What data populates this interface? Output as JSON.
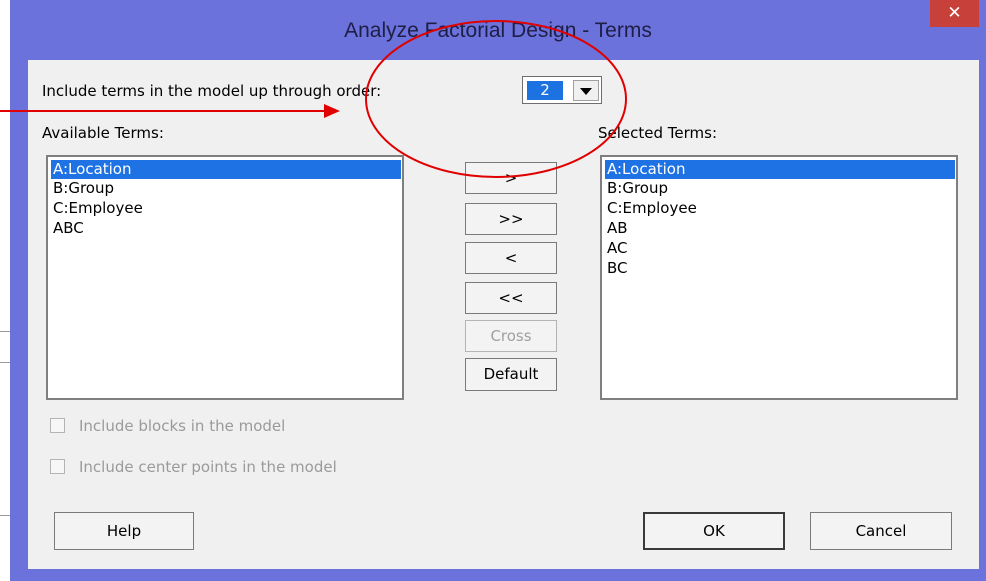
{
  "window": {
    "title": "Analyze Factorial Design - Terms",
    "close_glyph": "✕"
  },
  "order": {
    "label": "Include terms in the model up through order:",
    "value": "2"
  },
  "available": {
    "label": "Available Terms:",
    "items": [
      "A:Location",
      "B:Group",
      "C:Employee",
      "ABC"
    ]
  },
  "selected": {
    "label": "Selected Terms:",
    "items": [
      "A:Location",
      "B:Group",
      "C:Employee",
      "AB",
      "AC",
      "BC"
    ]
  },
  "buttons": {
    "add": ">",
    "add_all": ">>",
    "remove": "<",
    "remove_all": "<<",
    "cross": "Cross",
    "default": "Default",
    "help": "Help",
    "ok": "OK",
    "cancel": "Cancel"
  },
  "options": {
    "blocks": "Include blocks in the model",
    "center_points": "Include center points in the model"
  },
  "annotation": {
    "color": "#e00000"
  }
}
